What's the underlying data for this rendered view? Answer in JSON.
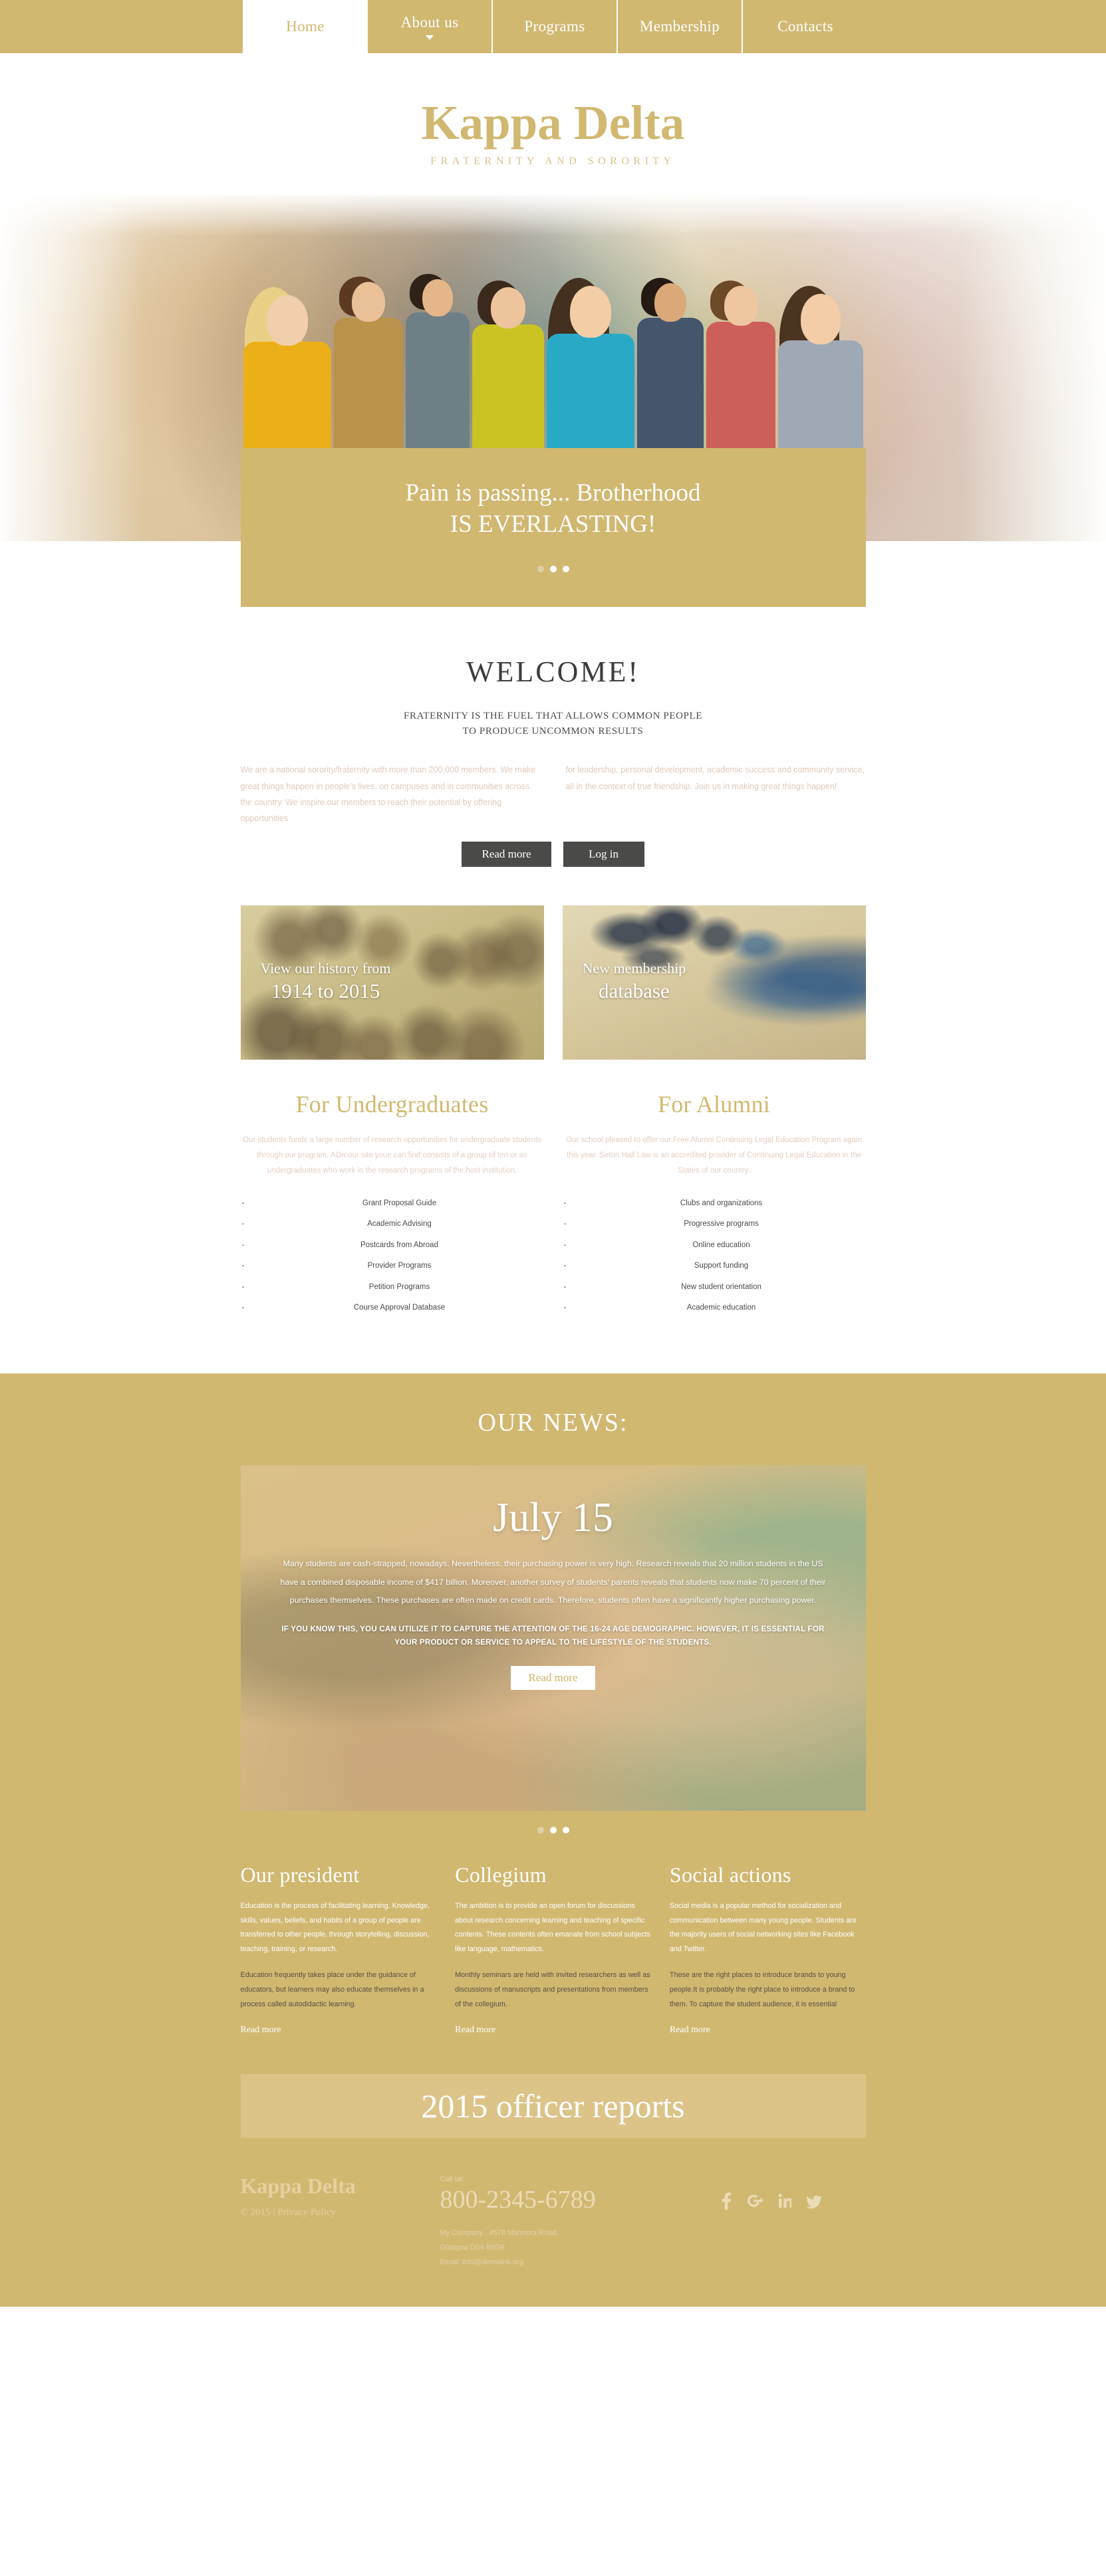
{
  "nav": {
    "items": [
      {
        "label": "Home",
        "active": true,
        "has_caret": false
      },
      {
        "label": "About us",
        "active": false,
        "has_caret": true
      },
      {
        "label": "Programs",
        "active": false,
        "has_caret": false
      },
      {
        "label": "Membership",
        "active": false,
        "has_caret": false
      },
      {
        "label": "Contacts",
        "active": false,
        "has_caret": false
      }
    ]
  },
  "brand": {
    "title": "Kappa Delta",
    "subtitle": "FRATERNITY AND SORORITY"
  },
  "hero": {
    "caption_line1": "Pain is passing... Brotherhood",
    "caption_line2": "IS EVERLASTING!",
    "dots": 3,
    "active_dot": 2
  },
  "welcome": {
    "heading": "WELCOME!",
    "tagline_line1": "FRATERNITY IS THE FUEL THAT ALLOWS COMMON PEOPLE",
    "tagline_line2": "TO PRODUCE UNCOMMON RESULTS",
    "paragraph_left": "We are a national sorority/fraternity with more than 200,000 members. We make great things happen in people's lives, on campuses and in communities across the country. We inspire our members to reach their potential by offering opportunities",
    "paragraph_right": "for leadership, personal development, academic success and community service, all in the context of true friendship. Join us in making great things happen!",
    "button_read_more": "Read more",
    "button_log_in": "Log in"
  },
  "promos": [
    {
      "small": "View our history from",
      "big": "1914 to 2015"
    },
    {
      "small": "New membership",
      "big": "database"
    }
  ],
  "columns": [
    {
      "title": "For Undergraduates",
      "intro": "Our students funds a large number of research opportunities for undergraduate students through our program. AOn our site youe can find consists of a group of ten or so undergraduates who work in the research programs of the host institution.",
      "items": [
        "Grant Proposal Guide",
        "Academic Advising",
        "Postcards from Abroad",
        "Provider Programs",
        "Petition Programs",
        "Course Approval Database"
      ]
    },
    {
      "title": "For Alumni",
      "intro": "Our school pleased to offer our Free Alumni Continuing Legal Education Program again this year. Seton Hall Law is an accredited provider of Continuing Legal Education in the States of our country.",
      "items": [
        "Clubs and organizations",
        "Progressive programs",
        "Online education",
        "Support funding",
        "New student orientation",
        "Academic education"
      ]
    }
  ],
  "news": {
    "heading": "OUR NEWS:",
    "date": "July 15",
    "paragraph": "Many students are cash-strapped, nowadays. Nevertheless, their purchasing power is very high. Research reveals that 20 million students in the US have a combined disposable income of $417 billion. Moreover, another survey of students' parents reveals that students now make 70 percent of their purchases themselves. These purchases are often made on credit cards. Therefore, students often have a significantly higher purchasing power.",
    "emphasis": "IF YOU KNOW THIS, YOU CAN UTILIZE IT TO CAPTURE THE ATTENTION OF THE 16-24 AGE DEMOGRAPHIC. HOWEVER, IT IS ESSENTIAL FOR YOUR PRODUCT OR SERVICE TO APPEAL TO THE LIFESTYLE OF THE STUDENTS.",
    "button": "Read more",
    "dots": 3,
    "active_dot": 2
  },
  "three_columns": [
    {
      "title": "Our president",
      "paragraph1": "Education is the process of facilitating learning. Knowledge, skills, values, beliefs, and habits of a group of people are transferred to other people, through storytelling, discussion, teaching, training, or research.",
      "paragraph2": "Education frequently takes place under the guidance of educators, but learners may also educate themselves in a process called autodidactic learning.",
      "link": "Read more"
    },
    {
      "title": "Collegium",
      "paragraph1": "The ambition is to provide an open forum for discussions about research concerning learning and teaching of specific contents. These contents often emanate from school subjects like language, mathematics.",
      "paragraph2": "Monthly seminars are held with invited researchers as well as discussions of manuscripts and presentations from members of the collegium.",
      "link": "Read more"
    },
    {
      "title": "Social actions",
      "paragraph1": "Social media is a popular method for socialization and communication between many young people. Students are the majority users of social networking sites like Facebook and Twitter.",
      "paragraph2": "These are the right places to introduce brands to young people.It is probably the right place to introduce a brand to them. To capture the student audience, it is essential",
      "link": "Read more"
    }
  ],
  "reports_banner": "2015 officer reports",
  "footer": {
    "brand": "Kappa Delta",
    "copyright": "© 2015 | Privacy Policy",
    "call_us_label": "Call us:",
    "phone": "800-2345-6789",
    "address_line1": "My Company , 4578 Marmora Road,",
    "address_line2": "Glasgow D04 89GR",
    "address_line3": "Email: info@demolink.org",
    "social": [
      "facebook-icon",
      "google-plus-icon",
      "linkedin-icon",
      "twitter-icon"
    ]
  },
  "colors": {
    "gold": "#d1b871",
    "gold_light": "#dcc489",
    "gold_text": "#d2b96f",
    "dark_button": "#4a4a48",
    "white": "#ffffff"
  }
}
